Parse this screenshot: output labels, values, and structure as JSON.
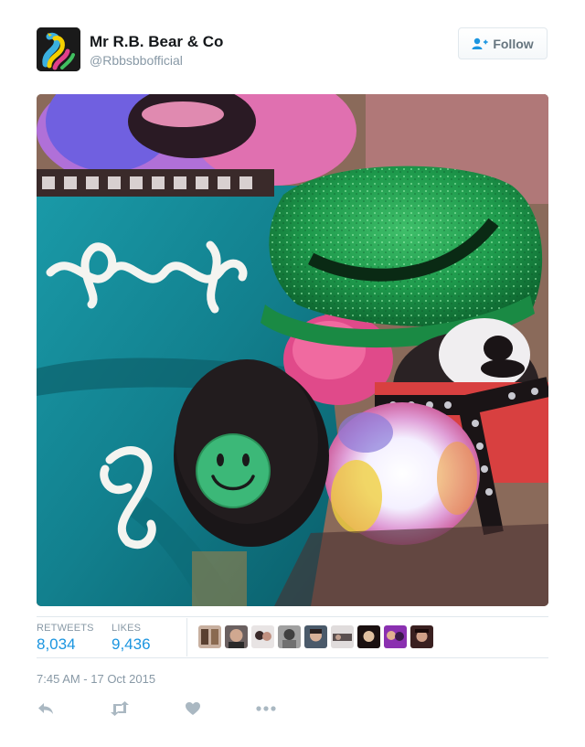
{
  "user": {
    "display_name": "Mr R.B. Bear & Co",
    "handle": "@Rbbsbbofficial"
  },
  "follow_button": {
    "label": "Follow",
    "icon": "add-user-icon"
  },
  "stats": {
    "retweets_label": "RETWEETS",
    "retweets_value": "8,034",
    "likes_label": "LIKES",
    "likes_value": "9,436"
  },
  "likers_count": 9,
  "timestamp": "7:45 AM - 17 Oct 2015",
  "actions": [
    {
      "name": "reply",
      "icon": "reply-icon"
    },
    {
      "name": "retweet",
      "icon": "retweet-icon"
    },
    {
      "name": "like",
      "icon": "heart-icon"
    },
    {
      "name": "more",
      "icon": "more-icon"
    }
  ],
  "colors": {
    "link_blue": "#1b95e0",
    "muted_gray": "#8899a6",
    "action_gray": "#aab8c2",
    "border": "#e1e8ed"
  }
}
